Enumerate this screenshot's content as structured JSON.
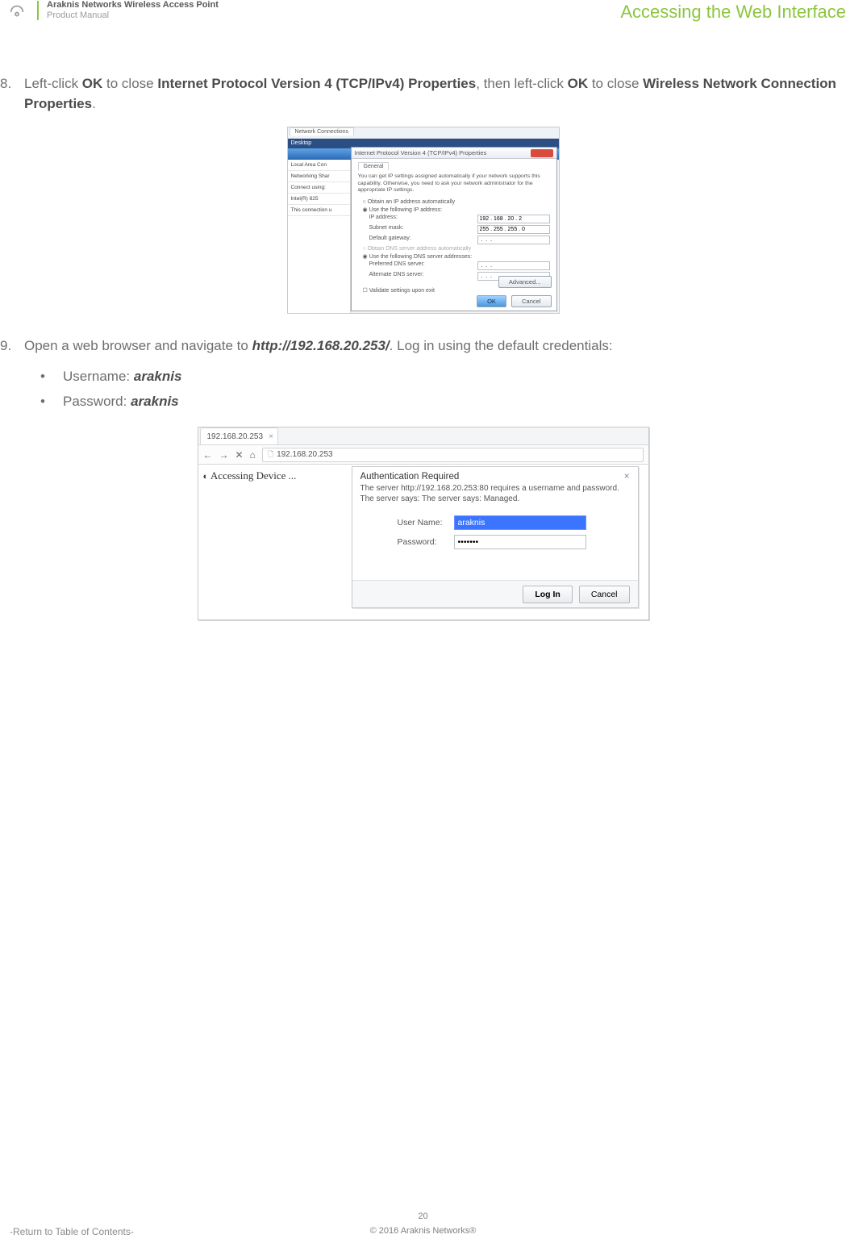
{
  "header": {
    "productLine1": "Araknis Networks Wireless Access Point",
    "productLine2": "Product Manual",
    "section": "Accessing the Web Interface"
  },
  "step8": {
    "num": "8.",
    "pre": "Left-click ",
    "b1": "OK",
    "mid1": " to close ",
    "b2": "Internet Protocol Version 4 (TCP/IPv4) Properties",
    "mid2": ", then left-click ",
    "b3": "OK",
    "mid3": " to close ",
    "b4": "Wireless Network Connection Properties",
    "post": "."
  },
  "fig1": {
    "tab": "Network Connections",
    "desk": "Desktop",
    "leftItems": [
      "Local Area Con",
      "Networking   Shar",
      "Connect using:",
      " Intel(R) 825",
      "This connection u"
    ],
    "dlgTitle": "Internet Protocol Version 4 (TCP/IPv4) Properties",
    "innerTab": "General",
    "note": "You can get IP settings assigned automatically if your network supports this capability. Otherwise, you need to ask your network administrator for the appropriate IP settings.",
    "rObtainIP": "Obtain an IP address automatically",
    "rUseIP": "Use the following IP address:",
    "ipLabel": "IP address:",
    "ipVal": "192 . 168 . 20 . 2",
    "maskLabel": "Subnet mask:",
    "maskVal": "255 . 255 . 255 . 0",
    "gwLabel": "Default gateway:",
    "gwVal": " .  .  . ",
    "rObtainDNS": "Obtain DNS server address automatically",
    "rUseDNS": "Use the following DNS server addresses:",
    "dns1Label": "Preferred DNS server:",
    "dns1Val": " .  .  . ",
    "dns2Label": "Alternate DNS server:",
    "dns2Val": " .  .  . ",
    "validate": "Validate settings upon exit",
    "advanced": "Advanced...",
    "ok": "OK",
    "cancel": "Cancel"
  },
  "step9": {
    "num": "9.",
    "pre": "Open a web browser and navigate to ",
    "url": "http://192.168.20.253/",
    "post": ". Log in using the default credentials:",
    "userLine": "Username: ",
    "userVal": "araknis",
    "passLine": "Password: ",
    "passVal": "araknis"
  },
  "fig2": {
    "tabLabel": "192.168.20.253",
    "urlText": "192.168.20.253",
    "loading": "Accessing Device ...",
    "dlgTitle": "Authentication Required",
    "dlgMsg": "The server http://192.168.20.253:80 requires a username and password. The server says: The server says: Managed.",
    "userLabel": "User Name:",
    "userVal": "araknis",
    "passLabel": "Password:",
    "passVal": "•••••••",
    "login": "Log In",
    "cancel": "Cancel"
  },
  "footer": {
    "page": "20",
    "copy": "© 2016 Araknis Networks®",
    "toc": "-Return to Table of Contents-"
  }
}
